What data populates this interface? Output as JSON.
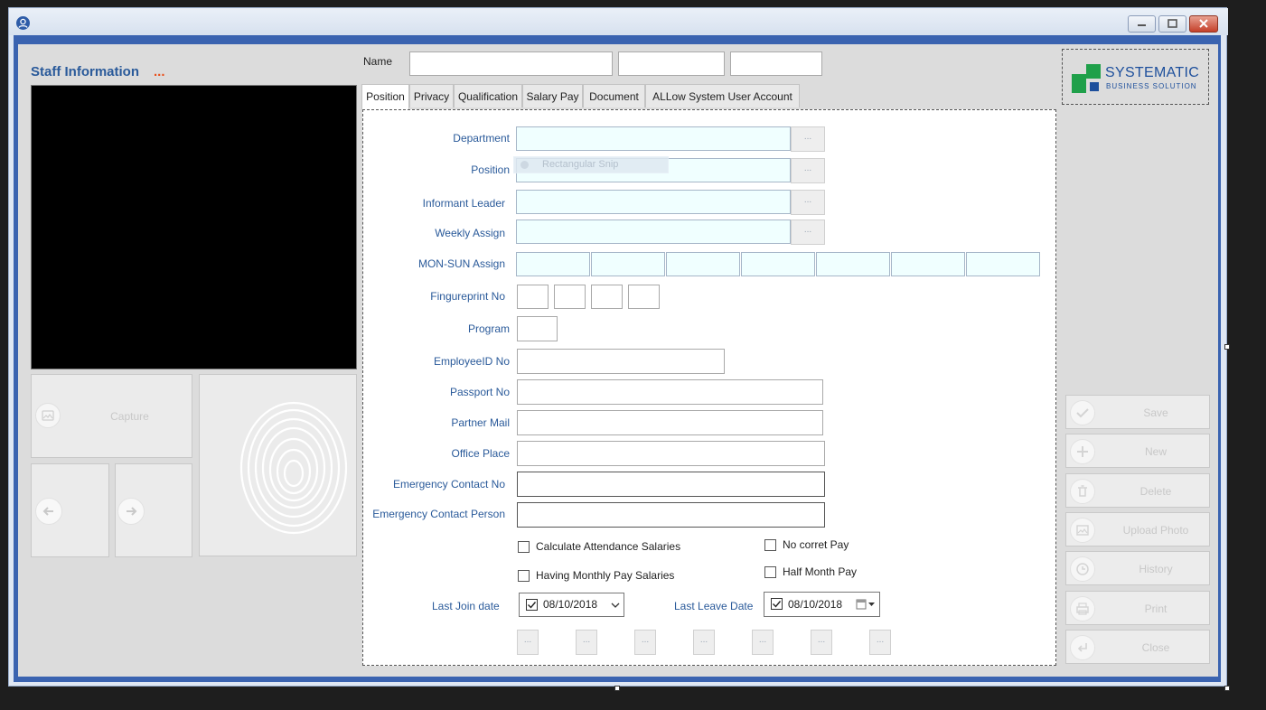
{
  "window": {
    "close_glyph": "✕"
  },
  "left": {
    "title": "Staff Information",
    "title_dots": "...",
    "capture_label": "Capture",
    "icons": [
      "photo-icon",
      "arrow-left-icon",
      "arrow-right-icon",
      "fingerprint-icon"
    ]
  },
  "top": {
    "name_label": "Name",
    "name_first": "",
    "name_middle": "",
    "name_last": ""
  },
  "logo": {
    "line1": "SYSTEMATIC",
    "line2": "BUSINESS SOLUTION"
  },
  "tabs": [
    {
      "label": "Position"
    },
    {
      "label": "Privacy"
    },
    {
      "label": "Qualification"
    },
    {
      "label": "Salary Pay"
    },
    {
      "label": "Document"
    },
    {
      "label": "ALLow System User Account"
    }
  ],
  "form": {
    "department_label": "Department",
    "position_label": "Position",
    "position_overlay": "Rectangular Snip",
    "informant_leader_label": "Informant Leader",
    "weekly_assign_label": "Weekly Assign",
    "mon_sun_assign_label": "MON-SUN Assign",
    "fingerprint_no_label": "Fingureprint No",
    "program_label": "Program",
    "employee_id_label": "EmployeeID No",
    "passport_no_label": "Passport No",
    "partner_mail_label": "Partner Mail",
    "office_place_label": "Office Place",
    "emergency_contact_no_label": "Emergency Contact No",
    "emergency_contact_person_label": "Emergency Contact Person",
    "dots": "...",
    "calc_attendance_label": "Calculate Attendance Salaries",
    "having_monthly_label": "Having Monthly Pay Salaries",
    "no_corret_pay_label": "No corret Pay",
    "half_month_pay_label": "Half Month Pay",
    "last_join_label": "Last Join date",
    "last_join_value": "08/10/2018",
    "last_leave_label": "Last Leave Date",
    "last_leave_value": "08/10/2018"
  },
  "actions": [
    {
      "label": "Save",
      "icon": "check-icon"
    },
    {
      "label": "New",
      "icon": "plus-icon"
    },
    {
      "label": "Delete",
      "icon": "trash-icon"
    },
    {
      "label": "Upload Photo",
      "icon": "photo-icon"
    },
    {
      "label": "History",
      "icon": "clock-icon"
    },
    {
      "label": "Print",
      "icon": "printer-icon"
    },
    {
      "label": "Close",
      "icon": "return-icon"
    }
  ],
  "colors": {
    "frame": "#3a63b0",
    "title_accent": "#e8501c",
    "label": "#2a5a9a",
    "logo_green": "#1fa04a",
    "logo_blue": "#1d4f9c"
  }
}
